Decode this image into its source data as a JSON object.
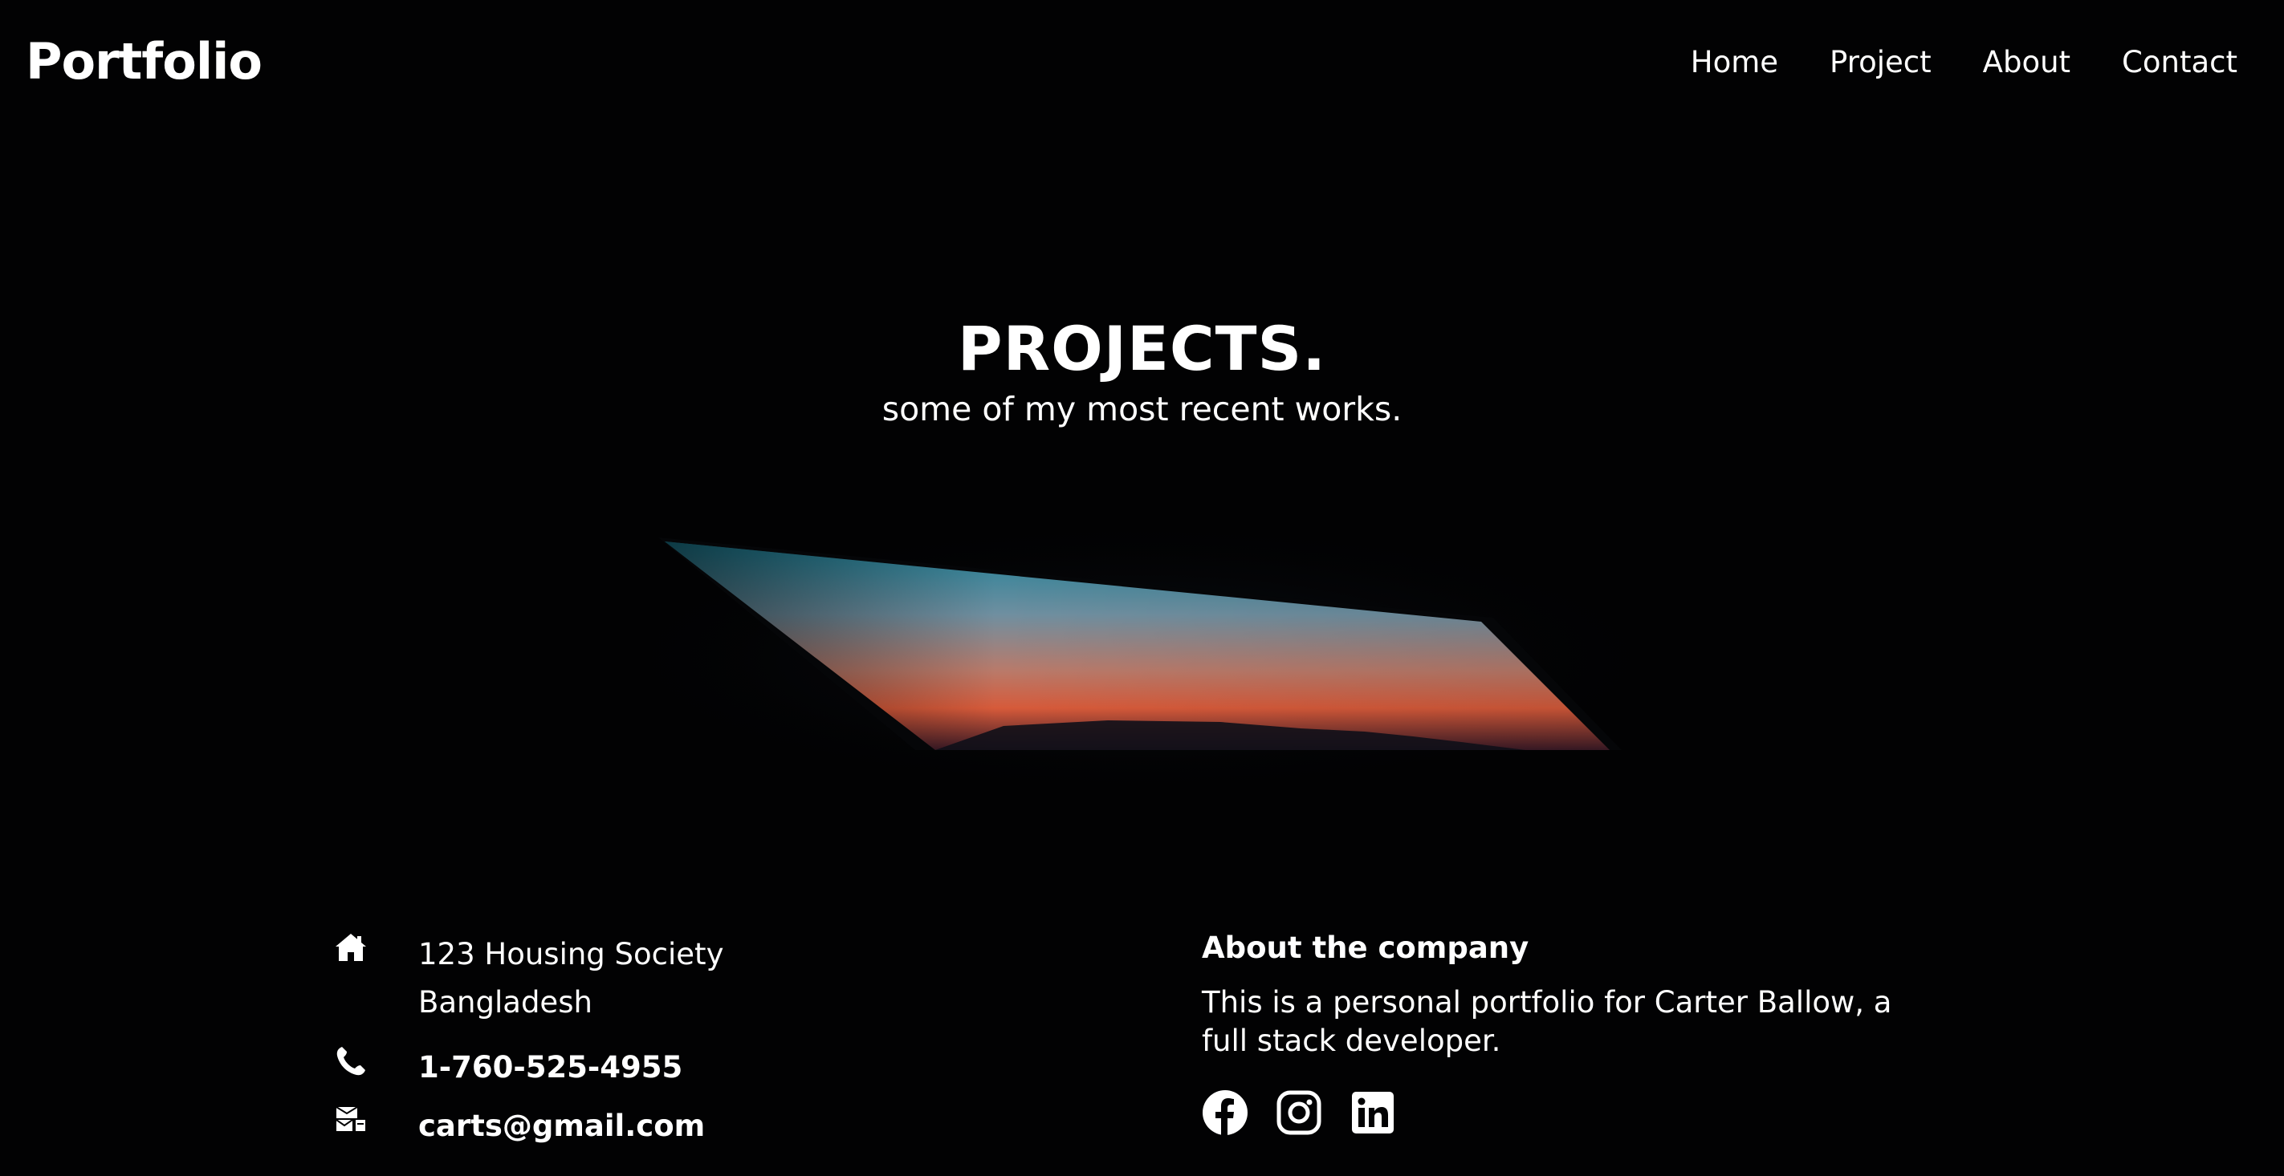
{
  "header": {
    "brand": "Portfolio",
    "nav": [
      "Home",
      "Project",
      "About",
      "Contact"
    ]
  },
  "hero": {
    "title": "PROJECTS.",
    "subtitle": "some of my most recent works."
  },
  "footer": {
    "address_line1": "123 Housing Society",
    "address_line2": "Bangladesh",
    "phone": "1-760-525-4955",
    "email": "carts@gmail.com",
    "about_heading": "About the company",
    "about_text": "This is a personal portfolio for Carter Ballow, a full stack developer.",
    "socials": [
      "facebook-icon",
      "instagram-icon",
      "linkedin-icon"
    ]
  },
  "colors": {
    "background": "#020203",
    "text": "#ffffff"
  }
}
